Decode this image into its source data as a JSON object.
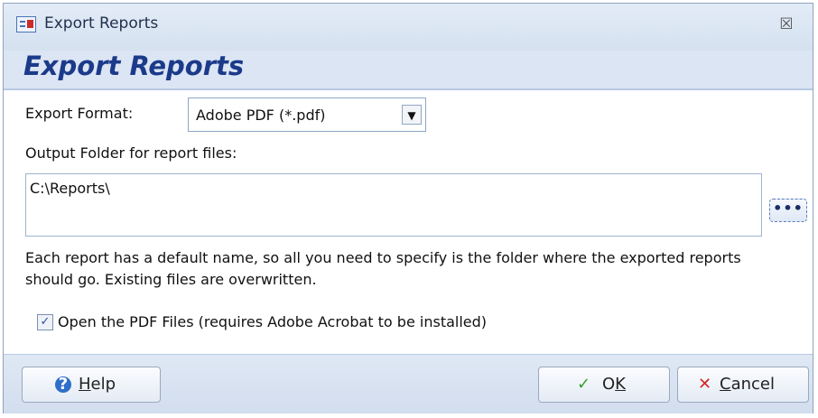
{
  "window": {
    "title": "Export Reports",
    "close_glyph": "☒"
  },
  "header": {
    "heading": "Export Reports"
  },
  "export_format": {
    "label": "Export Format:",
    "selected": "Adobe PDF (*.pdf)",
    "dropdown_glyph": "▼"
  },
  "output_folder": {
    "label": "Output Folder for report files:",
    "value": "C:\\Reports\\",
    "browse_label": "•••"
  },
  "description": "Each report has a default name, so all you need to specify is the folder where the exported reports should go. Existing files are overwritten.",
  "open_pdf": {
    "checked": true,
    "check_glyph": "✓",
    "label": "Open the PDF Files (requires Adobe Acrobat to be installed)"
  },
  "buttons": {
    "help": {
      "icon_glyph": "?",
      "mnemonic": "H",
      "rest": "elp"
    },
    "ok": {
      "icon_glyph": "✓",
      "mnemonic": "K",
      "pre": "O",
      "rest": ""
    },
    "cancel": {
      "icon_glyph": "✕",
      "mnemonic": "C",
      "rest": "ancel"
    }
  },
  "colors": {
    "heading": "#1b3a8a",
    "band": "#dbe5f3",
    "ok_icon": "#3a9d2c",
    "cancel_icon": "#d42525",
    "help_icon": "#2f6fc9"
  },
  "icons": {
    "app": "report-form-icon",
    "close": "close-icon",
    "help": "help-icon",
    "ok": "checkmark-icon",
    "cancel": "x-icon",
    "dropdown": "chevron-down-icon"
  }
}
